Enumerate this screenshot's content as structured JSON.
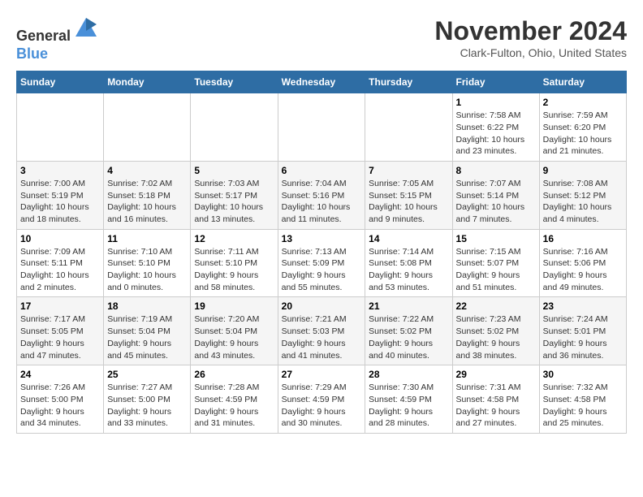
{
  "logo": {
    "line1": "General",
    "line2": "Blue"
  },
  "title": "November 2024",
  "location": "Clark-Fulton, Ohio, United States",
  "days_header": [
    "Sunday",
    "Monday",
    "Tuesday",
    "Wednesday",
    "Thursday",
    "Friday",
    "Saturday"
  ],
  "weeks": [
    [
      {
        "day": "",
        "info": ""
      },
      {
        "day": "",
        "info": ""
      },
      {
        "day": "",
        "info": ""
      },
      {
        "day": "",
        "info": ""
      },
      {
        "day": "",
        "info": ""
      },
      {
        "day": "1",
        "info": "Sunrise: 7:58 AM\nSunset: 6:22 PM\nDaylight: 10 hours and 23 minutes."
      },
      {
        "day": "2",
        "info": "Sunrise: 7:59 AM\nSunset: 6:20 PM\nDaylight: 10 hours and 21 minutes."
      }
    ],
    [
      {
        "day": "3",
        "info": "Sunrise: 7:00 AM\nSunset: 5:19 PM\nDaylight: 10 hours and 18 minutes."
      },
      {
        "day": "4",
        "info": "Sunrise: 7:02 AM\nSunset: 5:18 PM\nDaylight: 10 hours and 16 minutes."
      },
      {
        "day": "5",
        "info": "Sunrise: 7:03 AM\nSunset: 5:17 PM\nDaylight: 10 hours and 13 minutes."
      },
      {
        "day": "6",
        "info": "Sunrise: 7:04 AM\nSunset: 5:16 PM\nDaylight: 10 hours and 11 minutes."
      },
      {
        "day": "7",
        "info": "Sunrise: 7:05 AM\nSunset: 5:15 PM\nDaylight: 10 hours and 9 minutes."
      },
      {
        "day": "8",
        "info": "Sunrise: 7:07 AM\nSunset: 5:14 PM\nDaylight: 10 hours and 7 minutes."
      },
      {
        "day": "9",
        "info": "Sunrise: 7:08 AM\nSunset: 5:12 PM\nDaylight: 10 hours and 4 minutes."
      }
    ],
    [
      {
        "day": "10",
        "info": "Sunrise: 7:09 AM\nSunset: 5:11 PM\nDaylight: 10 hours and 2 minutes."
      },
      {
        "day": "11",
        "info": "Sunrise: 7:10 AM\nSunset: 5:10 PM\nDaylight: 10 hours and 0 minutes."
      },
      {
        "day": "12",
        "info": "Sunrise: 7:11 AM\nSunset: 5:10 PM\nDaylight: 9 hours and 58 minutes."
      },
      {
        "day": "13",
        "info": "Sunrise: 7:13 AM\nSunset: 5:09 PM\nDaylight: 9 hours and 55 minutes."
      },
      {
        "day": "14",
        "info": "Sunrise: 7:14 AM\nSunset: 5:08 PM\nDaylight: 9 hours and 53 minutes."
      },
      {
        "day": "15",
        "info": "Sunrise: 7:15 AM\nSunset: 5:07 PM\nDaylight: 9 hours and 51 minutes."
      },
      {
        "day": "16",
        "info": "Sunrise: 7:16 AM\nSunset: 5:06 PM\nDaylight: 9 hours and 49 minutes."
      }
    ],
    [
      {
        "day": "17",
        "info": "Sunrise: 7:17 AM\nSunset: 5:05 PM\nDaylight: 9 hours and 47 minutes."
      },
      {
        "day": "18",
        "info": "Sunrise: 7:19 AM\nSunset: 5:04 PM\nDaylight: 9 hours and 45 minutes."
      },
      {
        "day": "19",
        "info": "Sunrise: 7:20 AM\nSunset: 5:04 PM\nDaylight: 9 hours and 43 minutes."
      },
      {
        "day": "20",
        "info": "Sunrise: 7:21 AM\nSunset: 5:03 PM\nDaylight: 9 hours and 41 minutes."
      },
      {
        "day": "21",
        "info": "Sunrise: 7:22 AM\nSunset: 5:02 PM\nDaylight: 9 hours and 40 minutes."
      },
      {
        "day": "22",
        "info": "Sunrise: 7:23 AM\nSunset: 5:02 PM\nDaylight: 9 hours and 38 minutes."
      },
      {
        "day": "23",
        "info": "Sunrise: 7:24 AM\nSunset: 5:01 PM\nDaylight: 9 hours and 36 minutes."
      }
    ],
    [
      {
        "day": "24",
        "info": "Sunrise: 7:26 AM\nSunset: 5:00 PM\nDaylight: 9 hours and 34 minutes."
      },
      {
        "day": "25",
        "info": "Sunrise: 7:27 AM\nSunset: 5:00 PM\nDaylight: 9 hours and 33 minutes."
      },
      {
        "day": "26",
        "info": "Sunrise: 7:28 AM\nSunset: 4:59 PM\nDaylight: 9 hours and 31 minutes."
      },
      {
        "day": "27",
        "info": "Sunrise: 7:29 AM\nSunset: 4:59 PM\nDaylight: 9 hours and 30 minutes."
      },
      {
        "day": "28",
        "info": "Sunrise: 7:30 AM\nSunset: 4:59 PM\nDaylight: 9 hours and 28 minutes."
      },
      {
        "day": "29",
        "info": "Sunrise: 7:31 AM\nSunset: 4:58 PM\nDaylight: 9 hours and 27 minutes."
      },
      {
        "day": "30",
        "info": "Sunrise: 7:32 AM\nSunset: 4:58 PM\nDaylight: 9 hours and 25 minutes."
      }
    ]
  ]
}
